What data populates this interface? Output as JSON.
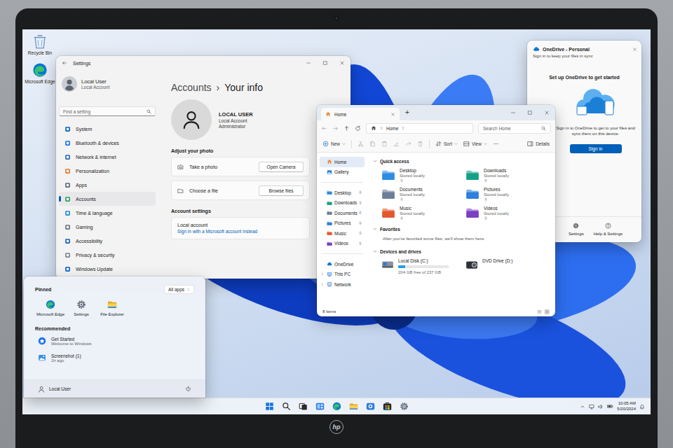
{
  "laptop": {
    "brand": "hp"
  },
  "desktop": {
    "icons": [
      {
        "label": "Recycle Bin",
        "kind": "recycle"
      },
      {
        "label": "Microsoft Edge",
        "kind": "edge"
      }
    ]
  },
  "settings": {
    "title": "Settings",
    "user": {
      "name": "Local User",
      "type": "Local Account"
    },
    "search": {
      "placeholder": "Find a setting"
    },
    "nav": [
      {
        "label": "System",
        "selected": false,
        "color": "#0067c0"
      },
      {
        "label": "Bluetooth & devices",
        "selected": false,
        "color": "#1a73e8"
      },
      {
        "label": "Network & internet",
        "selected": false,
        "color": "#2b6cb0"
      },
      {
        "label": "Personalization",
        "selected": false,
        "color": "#e07a2f"
      },
      {
        "label": "Apps",
        "selected": false,
        "color": "#5a6b80"
      },
      {
        "label": "Accounts",
        "selected": true,
        "color": "#2f9e5a"
      },
      {
        "label": "Time & language",
        "selected": false,
        "color": "#1f8fd6"
      },
      {
        "label": "Gaming",
        "selected": false,
        "color": "#6b7280"
      },
      {
        "label": "Accessibility",
        "selected": false,
        "color": "#1565c0"
      },
      {
        "label": "Privacy & security",
        "selected": false,
        "color": "#7a8594"
      },
      {
        "label": "Windows Update",
        "selected": false,
        "color": "#0a64c8"
      }
    ],
    "breadcrumb": {
      "parent": "Accounts",
      "separator": "›",
      "current": "Your info"
    },
    "profile": {
      "name": "LOCAL USER",
      "type": "Local Account",
      "role": "Administrator"
    },
    "photo": {
      "heading": "Adjust your photo",
      "rows": [
        {
          "label": "Take a photo",
          "button": "Open Camera",
          "kind": "camera"
        },
        {
          "label": "Choose a file",
          "button": "Browse files",
          "kind": "file"
        }
      ]
    },
    "account": {
      "heading": "Account settings",
      "label": "Local account",
      "link": "Sign in with a Microsoft account instead"
    }
  },
  "explorer": {
    "tabs": [
      {
        "label": "Home",
        "selected": true
      }
    ],
    "new_tab": "+",
    "address": {
      "path": [
        "Home"
      ]
    },
    "search": {
      "placeholder": "Search Home"
    },
    "toolbar": {
      "new": "New",
      "actions": [
        {
          "kind": "cut",
          "disabled": true
        },
        {
          "kind": "copy",
          "disabled": true
        },
        {
          "kind": "paste",
          "disabled": true
        },
        {
          "kind": "rename",
          "disabled": true
        },
        {
          "kind": "share",
          "disabled": true
        },
        {
          "kind": "delete",
          "disabled": true
        }
      ],
      "sort": "Sort",
      "view": "View",
      "details": "Details"
    },
    "nav": [
      [
        {
          "label": "Home",
          "kind": "home",
          "selected": true,
          "pinned": false,
          "expandable": false
        },
        {
          "label": "Gallery",
          "kind": "gallery",
          "selected": false,
          "pinned": false,
          "expandable": false
        }
      ],
      [
        {
          "label": "Desktop",
          "kind": "folder",
          "color": "#2d8ce3",
          "selected": false,
          "pinned": true,
          "expandable": false
        },
        {
          "label": "Downloads",
          "kind": "folder",
          "color": "#16a085",
          "selected": false,
          "pinned": true,
          "expandable": false
        },
        {
          "label": "Documents",
          "kind": "folder",
          "color": "#6b7f99",
          "selected": false,
          "pinned": true,
          "expandable": false
        },
        {
          "label": "Pictures",
          "kind": "folder",
          "color": "#2f7fdc",
          "selected": false,
          "pinned": true,
          "expandable": false
        },
        {
          "label": "Music",
          "kind": "folder",
          "color": "#e4572e",
          "selected": false,
          "pinned": true,
          "expandable": false
        },
        {
          "label": "Videos",
          "kind": "folder",
          "color": "#7a3fc2",
          "selected": false,
          "pinned": true,
          "expandable": false
        }
      ],
      [
        {
          "label": "OneDrive",
          "kind": "cloud",
          "selected": false,
          "pinned": false,
          "expandable": false
        },
        {
          "label": "This PC",
          "kind": "pc",
          "selected": false,
          "pinned": false,
          "expandable": true
        },
        {
          "label": "Network",
          "kind": "network",
          "selected": false,
          "pinned": false,
          "expandable": true
        }
      ]
    ],
    "sections": [
      {
        "title": "Quick access",
        "kind": "folders",
        "expanded": true,
        "items": [
          {
            "name": "Desktop",
            "detail": "Stored locally",
            "pinned": true,
            "color": "#2d8ce3"
          },
          {
            "name": "Downloads",
            "detail": "Stored locally",
            "pinned": true,
            "color": "#16a085"
          },
          {
            "name": "Documents",
            "detail": "Stored locally",
            "pinned": true,
            "color": "#6b7f99"
          },
          {
            "name": "Pictures",
            "detail": "Stored locally",
            "pinned": true,
            "color": "#2f7fdc"
          },
          {
            "name": "Music",
            "detail": "Stored locally",
            "pinned": true,
            "color": "#e4572e"
          },
          {
            "name": "Videos",
            "detail": "Stored locally",
            "pinned": true,
            "color": "#7a3fc2"
          }
        ]
      },
      {
        "title": "Favorites",
        "kind": "empty",
        "expanded": true,
        "message": "After you've favorited some files, we'll show them here."
      },
      {
        "title": "Devices and drives",
        "kind": "drives",
        "expanded": true,
        "items": [
          {
            "name": "Local Disk (C:)",
            "kind": "disk",
            "detail": "204 GB free of 237 GB",
            "level": 0.14
          },
          {
            "name": "DVD Drive (D:)",
            "kind": "dvd"
          }
        ]
      }
    ],
    "status": {
      "count": "8 items"
    }
  },
  "onedrive": {
    "title": "OneDrive - Personal",
    "subtitle": "Sign in to keep your files in sync",
    "heading": "Set up OneDrive to get started",
    "body": "Sign in to OneDrive to get to your files and sync them on this device.",
    "button": "Sign in",
    "footer": [
      {
        "label": "Settings",
        "kind": "gear"
      },
      {
        "label": "Help & Settings",
        "kind": "help"
      }
    ]
  },
  "start": {
    "pinned_title": "Pinned",
    "all_apps": "All apps",
    "pinned": [
      {
        "label": "Microsoft Edge",
        "kind": "edge"
      },
      {
        "label": "Settings",
        "kind": "gear"
      },
      {
        "label": "File Explorer",
        "kind": "explorer"
      }
    ],
    "recommended_title": "Recommended",
    "recommended": [
      {
        "title": "Get Started",
        "subtitle": "Welcome to Windows",
        "kind": "getstarted"
      },
      {
        "title": "Screenshot (1)",
        "subtitle": "1h ago",
        "kind": "image"
      }
    ],
    "user": "Local User"
  },
  "taskbar": {
    "apps": [
      {
        "kind": "start"
      },
      {
        "kind": "search"
      },
      {
        "kind": "taskview"
      },
      {
        "kind": "widgets"
      },
      {
        "kind": "edge"
      },
      {
        "kind": "explorer"
      },
      {
        "kind": "camera"
      },
      {
        "kind": "store"
      },
      {
        "kind": "gear"
      }
    ],
    "time": "10:05 AM",
    "date": "5/20/2024"
  }
}
